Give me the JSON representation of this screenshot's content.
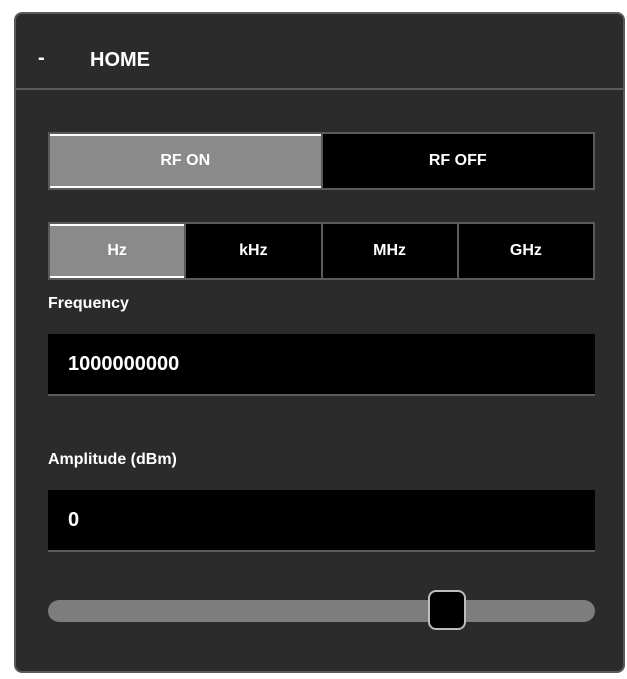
{
  "panel": {
    "collapse_symbol": "-",
    "title": "HOME"
  },
  "rf_toggle": {
    "options": [
      {
        "label": "RF ON",
        "active": true
      },
      {
        "label": "RF OFF",
        "active": false
      }
    ]
  },
  "units": {
    "options": [
      {
        "label": "Hz",
        "active": true
      },
      {
        "label": "kHz",
        "active": false
      },
      {
        "label": "MHz",
        "active": false
      },
      {
        "label": "GHz",
        "active": false
      }
    ]
  },
  "frequency": {
    "label": "Frequency",
    "value": "1000000000"
  },
  "amplitude": {
    "label": "Amplitude (dBm)",
    "value": "0",
    "slider_fraction": 0.73
  }
}
